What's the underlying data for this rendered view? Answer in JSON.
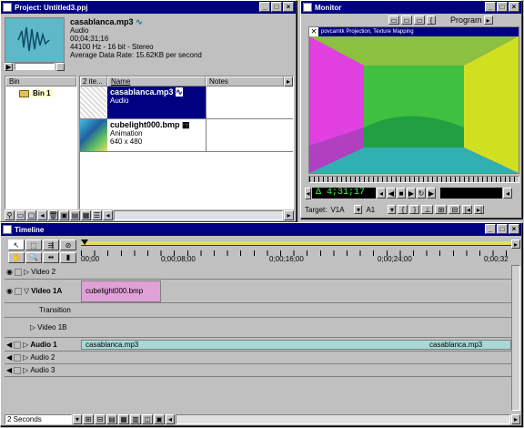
{
  "project": {
    "title": "Project: Untitled3.ppj",
    "clip": {
      "name": "casablanca.mp3",
      "type": "Audio",
      "duration": "00;04;31;16",
      "format": "44100 Hz - 16 bit - Stereo",
      "rate": "Average Data Rate: 15.62KB per second"
    },
    "bin_header": "Bin",
    "bin_item": "Bin 1",
    "items_header": "2 ite...",
    "name_header": "Name",
    "notes_header": "Notes",
    "items": [
      {
        "name": "casablanca.mp3",
        "sub1": "Audio",
        "sub2": ""
      },
      {
        "name": "cubelight000.bmp",
        "sub1": "Animation",
        "sub2": "640 x 480"
      }
    ]
  },
  "monitor": {
    "title": "Monitor",
    "program_label": "Program",
    "image_title": "povcamtk Projection, Texture Mapping",
    "timecode": "Δ 4;31;17",
    "target_label": "Target:",
    "target_video": "V1A",
    "target_audio": "A1"
  },
  "timeline": {
    "title": "Timeline",
    "ruler": [
      "00;00",
      "0;00;08;00",
      "0;00;16;00",
      "0;00;24;00",
      "0;00;32"
    ],
    "tracks": [
      {
        "label": "Video 2"
      },
      {
        "label": "Video 1A"
      },
      {
        "label": "Transition"
      },
      {
        "label": "Video 1B"
      },
      {
        "label": "Audio 1"
      },
      {
        "label": "Audio 2"
      },
      {
        "label": "Audio 3"
      }
    ],
    "video_clip": "cubelight000.bmp",
    "audio_clip": "casablanca.mp3",
    "audio_clip2": "casablanca.mp3",
    "zoom": "2 Seconds"
  },
  "colors": {
    "titlebar": "#000080",
    "audio_clip": "#a8d8d8",
    "video_clip": "#e0a0d8"
  }
}
